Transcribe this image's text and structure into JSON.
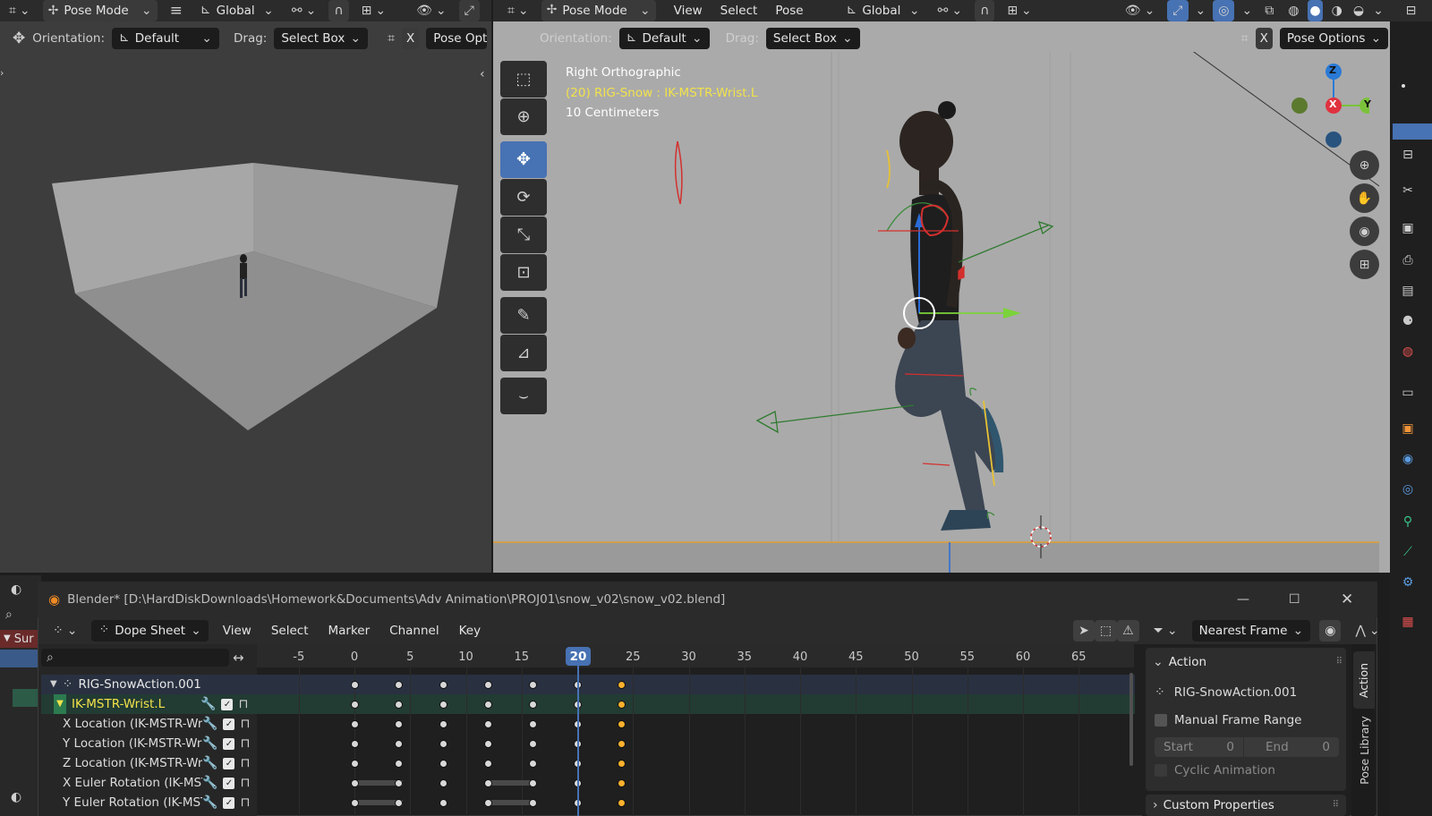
{
  "left_viewport": {
    "header": {
      "mode": "Pose Mode",
      "orientation_global": "Global"
    },
    "toolheader": {
      "orientation_label": "Orientation:",
      "orientation_value": "Default",
      "drag_label": "Drag:",
      "drag_value": "Select Box",
      "x_label": "X",
      "pose_options": "Pose Opti"
    }
  },
  "right_viewport": {
    "header": {
      "mode": "Pose Mode",
      "menus": [
        "View",
        "Select",
        "Pose"
      ],
      "orientation_global": "Global"
    },
    "toolheader": {
      "orientation_label": "Orientation:",
      "orientation_value": "Default",
      "drag_label": "Drag:",
      "drag_value": "Select Box",
      "x_label": "X",
      "pose_options": "Pose Options"
    },
    "overlay": {
      "view_name": "Right Orthographic",
      "active_object": "(20) RIG-Snow : IK-MSTR-Wrist.L",
      "scale": "10 Centimeters"
    },
    "gizmo": {
      "z": "Z",
      "x": "X",
      "y": "Y"
    }
  },
  "dopesheet_window": {
    "title": "Blender* [D:\\HardDiskDownloads\\Homework&Documents\\Adv Animation\\PROJ01\\snow_v02\\snow_v02.blend]",
    "editor": "Dope Sheet",
    "menus": [
      "View",
      "Select",
      "Marker",
      "Channel",
      "Key"
    ],
    "snap": "Nearest Frame",
    "current_frame": "20",
    "ticks": [
      "-5",
      "0",
      "5",
      "10",
      "15",
      "25",
      "30",
      "35",
      "40",
      "45",
      "50",
      "55",
      "60",
      "65"
    ],
    "channels": [
      {
        "name": "RIG-SnowAction.001"
      },
      {
        "name": "IK-MSTR-Wrist.L"
      },
      {
        "name": "X Location (IK-MSTR-Wris"
      },
      {
        "name": "Y Location (IK-MSTR-Wris"
      },
      {
        "name": "Z Location (IK-MSTR-Wris"
      },
      {
        "name": "X Euler Rotation (IK-MST"
      },
      {
        "name": "Y Euler Rotation (IK-MST"
      }
    ],
    "keyframe_frames": [
      0,
      4,
      8,
      12,
      16,
      20,
      24
    ],
    "selected_keyframe_frames": [
      24
    ],
    "side_panel": {
      "action_header": "Action",
      "action_name": "RIG-SnowAction.001",
      "manual_frame_range": "Manual Frame Range",
      "start_label": "Start",
      "start_value": "0",
      "end_label": "End",
      "end_value": "0",
      "cyclic": "Cyclic Animation",
      "custom_props": "Custom Properties"
    },
    "side_tabs": {
      "action": "Action",
      "pose_library": "Pose Library"
    }
  },
  "left_strip": {
    "sur": "Sur"
  },
  "colors": {
    "accent": "#4772b3",
    "active_bone": "#f2e24b",
    "selected_key": "#ffb22d",
    "channel_green": "#2c5b47"
  }
}
